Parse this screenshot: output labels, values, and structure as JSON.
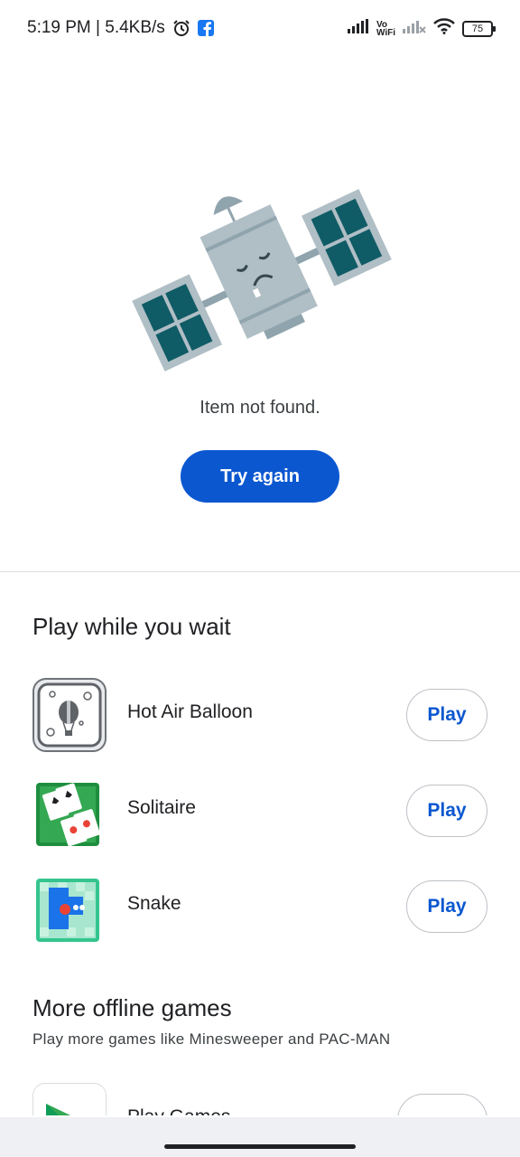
{
  "status_bar": {
    "time_speed": "5:19 PM | 5.4KB/s",
    "vowifi_top": "Vo",
    "vowifi_bottom": "WiFi",
    "battery": "75",
    "icons": [
      "alarm-icon",
      "facebook-icon",
      "signal-icon",
      "vowifi-icon",
      "signal-off-icon",
      "wifi-icon",
      "battery-icon"
    ]
  },
  "error": {
    "message": "Item not found.",
    "retry_label": "Try again"
  },
  "games_section": {
    "title": "Play while you wait",
    "games": [
      {
        "name": "Hot Air Balloon",
        "play_label": "Play",
        "icon": "hot-air-balloon-icon"
      },
      {
        "name": "Solitaire",
        "play_label": "Play",
        "icon": "solitaire-icon"
      },
      {
        "name": "Snake",
        "play_label": "Play",
        "icon": "snake-icon"
      }
    ]
  },
  "more_section": {
    "title": "More offline games",
    "subtitle": "Play more games like Minesweeper and PAC-MAN",
    "partial_item_name": "Play Games"
  },
  "colors": {
    "accent": "#0b57d0",
    "satellite_panel": "#0f5b66",
    "satellite_body": "#b0bec5"
  }
}
